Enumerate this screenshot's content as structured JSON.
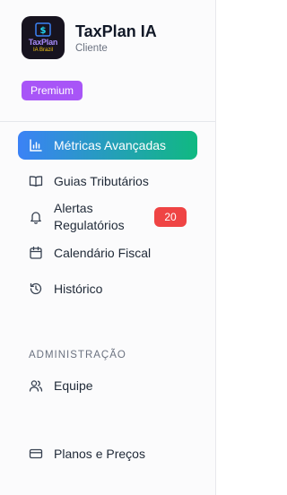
{
  "brand": {
    "name": "TaxPlan IA",
    "subtitle": "Cliente",
    "logo_line1": "TaxPlan",
    "logo_line2": "IA Brazil"
  },
  "plan_badge": "Premium",
  "nav": [
    {
      "label": "Métricas Avançadas",
      "icon": "bar-chart-icon",
      "active": true
    },
    {
      "label": "Guias Tributários",
      "icon": "book-open-icon"
    },
    {
      "label": "Alertas Regulatórios",
      "icon": "bell-icon",
      "badge": "20"
    },
    {
      "label": "Calendário Fiscal",
      "icon": "calendar-icon"
    },
    {
      "label": "Histórico",
      "icon": "history-icon"
    }
  ],
  "admin": {
    "title": "ADMINISTRAÇÃO",
    "items": [
      {
        "label": "Equipe",
        "icon": "users-icon"
      }
    ]
  },
  "billing": {
    "label": "Planos e Preços",
    "icon": "credit-card-icon"
  },
  "colors": {
    "accent_start": "#3b82f6",
    "accent_end": "#10b981",
    "premium": "#a855f7",
    "alert_badge": "#ef4444"
  }
}
